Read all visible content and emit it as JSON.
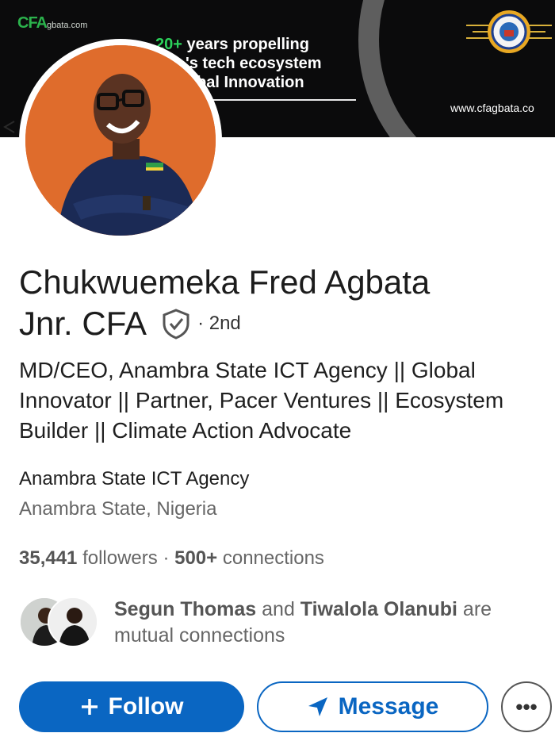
{
  "banner": {
    "logo_main": "CFA",
    "logo_sub": "gbata.com",
    "headline_accent": "20+",
    "headline_line1": " years propelling",
    "headline_line2": "'s tech ecosystem",
    "headline_line3": "bal Innovation",
    "url": "www.cfagbata.co"
  },
  "profile": {
    "name_line1": "Chukwuemeka Fred Agbata",
    "name_line2": "Jnr. CFA",
    "degree": "· 2nd",
    "headline": "MD/CEO, Anambra State ICT Agency || Global Innovator || Partner, Pacer Ventures || Ecosystem Builder || Climate Action Advocate",
    "company": "Anambra State ICT Agency",
    "location": "Anambra State, Nigeria"
  },
  "stats": {
    "followers_count": "35,441",
    "followers_label": " followers · ",
    "connections_count": "500+",
    "connections_label": " connections"
  },
  "mutual": {
    "person1": "Segun Thomas",
    "joiner": " and ",
    "person2": "Tiwalola Olanubi",
    "suffix": " are mutual connections"
  },
  "actions": {
    "follow_label": "Follow",
    "message_label": "Message",
    "more_label": "•••"
  },
  "colors": {
    "primary": "#0a66c2",
    "banner_bg": "#0b0b0c",
    "banner_accent": "#2bd15a"
  },
  "icons": {
    "verified": "shield-check-icon",
    "follow": "plus-icon",
    "message": "send-icon",
    "more": "more-horizontal-icon"
  }
}
